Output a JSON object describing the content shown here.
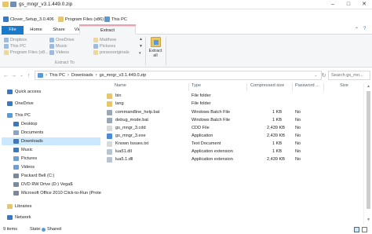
{
  "window": {
    "title": "gs_mngr_v3.1.449.0.zip",
    "controls": [
      "–",
      "□",
      "✕"
    ]
  },
  "bookmarks": [
    {
      "label": "Clover_Setup_3.0.406",
      "color": "#3b78c2"
    },
    {
      "label": "Program Files (x86)",
      "color": "#e8c66a"
    },
    {
      "label": "This PC",
      "color": "#5b9bd5"
    }
  ],
  "ribbon": {
    "tabs": [
      "File",
      "Home",
      "Share",
      "View",
      "Extract"
    ],
    "extract_to": {
      "col1": [
        "Dropbox",
        "This PC",
        "Program Files (x8..."
      ],
      "col2": [
        "OneDrive",
        "Music",
        "Videos"
      ],
      "col3": [
        "Matthew",
        "Pictures",
        "psraosoriginals"
      ],
      "group_label": "Extract To"
    },
    "extract_all": "Extract all"
  },
  "address": {
    "crumbs": [
      "This PC",
      "Downloads",
      "gs_mngr_v3.1.449.0.zip"
    ],
    "search_placeholder": "Search gs_mn..."
  },
  "nav_pane": [
    {
      "label": "Quick access",
      "icon": "star-icon",
      "color": "#3b78c2"
    },
    {
      "label": "OneDrive",
      "icon": "cloud-icon",
      "color": "#3b78c2"
    },
    {
      "label": "This PC",
      "icon": "computer-icon",
      "color": "#5b9bd5"
    },
    {
      "label": "Desktop",
      "icon": "desktop-icon",
      "color": "#3b78c2"
    },
    {
      "label": "Documents",
      "icon": "documents-icon",
      "color": "#8aa4c2"
    },
    {
      "label": "Downloads",
      "icon": "downloads-icon",
      "color": "#3b78c2"
    },
    {
      "label": "Music",
      "icon": "music-icon",
      "color": "#3b78c2"
    },
    {
      "label": "Pictures",
      "icon": "pictures-icon",
      "color": "#6da0d6"
    },
    {
      "label": "Videos",
      "icon": "videos-icon",
      "color": "#6da0d6"
    },
    {
      "label": "Packard Bell (C:)",
      "icon": "drive-icon",
      "color": "#7a8a9c"
    },
    {
      "label": "DVD RW Drive (D:) Vega$",
      "icon": "dvd-icon",
      "color": "#7a8a9c"
    },
    {
      "label": "Microsoft Office 2010 Click-to-Run (Prote",
      "icon": "drive-icon",
      "color": "#7a8a9c"
    },
    {
      "label": "Libraries",
      "icon": "libraries-icon",
      "color": "#e8c66a"
    },
    {
      "label": "Network",
      "icon": "network-icon",
      "color": "#3b78c2"
    }
  ],
  "columns": [
    "Name",
    "Type",
    "Compressed size",
    "Password ...",
    "Size"
  ],
  "files": [
    {
      "name": "bin",
      "type": "File folder",
      "compressed": "",
      "size": "",
      "color": "#e8c66a"
    },
    {
      "name": "lang",
      "type": "File folder",
      "compressed": "",
      "size": "",
      "color": "#e8c66a"
    },
    {
      "name": "commandline_help.bat",
      "type": "Windows Batch File",
      "compressed": "1 KB",
      "password": "No",
      "size": "",
      "color": "#9aa7b5"
    },
    {
      "name": "debug_mode.bat",
      "type": "Windows Batch File",
      "compressed": "1 KB",
      "password": "No",
      "size": "",
      "color": "#9aa7b5"
    },
    {
      "name": "gs_mngr_3.cdd",
      "type": "CDD File",
      "compressed": "2,439 KB",
      "password": "No",
      "size": "",
      "color": "#d9d9d9"
    },
    {
      "name": "gs_mngr_3.exe",
      "type": "Application",
      "compressed": "2,439 KB",
      "password": "No",
      "size": "",
      "color": "#4a8ad6"
    },
    {
      "name": "Known Issues.txt",
      "type": "Text Document",
      "compressed": "1 KB",
      "password": "No",
      "size": "",
      "color": "#d9d9d9"
    },
    {
      "name": "lua51.dll",
      "type": "Application extension",
      "compressed": "1 KB",
      "password": "No",
      "size": "",
      "color": "#b9c3cf"
    },
    {
      "name": "lua5.1.dll",
      "type": "Application extension",
      "compressed": "2,439 KB",
      "password": "No",
      "size": "",
      "color": "#b9c3cf"
    }
  ],
  "status": {
    "items": "9 items",
    "state": "State:",
    "shared": "Shared"
  }
}
